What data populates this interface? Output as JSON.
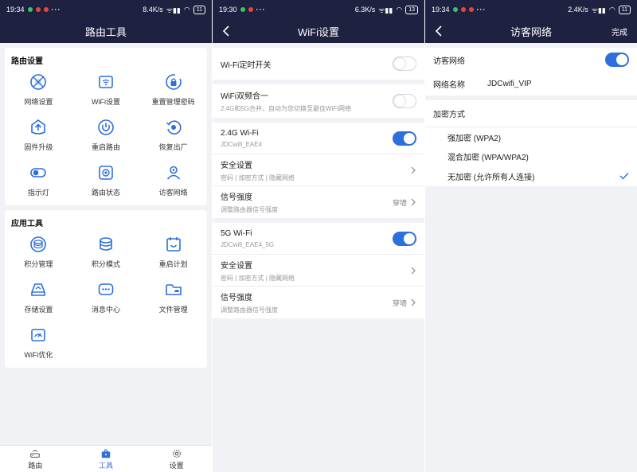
{
  "colors": {
    "navbar": "#1e2140",
    "accent": "#2d6fdb",
    "background": "#f1f2f6"
  },
  "screen1": {
    "status": {
      "time": "19:34",
      "dots": "···",
      "speed": "8.4K/s",
      "battery": "11"
    },
    "title": "路由工具",
    "router_section": {
      "title": "路由设置",
      "items": [
        {
          "label": "网络设置",
          "icon": "globe-icon"
        },
        {
          "label": "WiFi设置",
          "icon": "wifi-router-icon"
        },
        {
          "label": "重置管理密码",
          "icon": "lock-reset-icon"
        },
        {
          "label": "固件升级",
          "icon": "upgrade-icon"
        },
        {
          "label": "重启路由",
          "icon": "power-icon"
        },
        {
          "label": "恢复出厂",
          "icon": "restore-icon"
        },
        {
          "label": "指示灯",
          "icon": "toggle-light-icon"
        },
        {
          "label": "路由状态",
          "icon": "router-status-icon"
        },
        {
          "label": "访客网络",
          "icon": "guest-icon"
        }
      ]
    },
    "app_section": {
      "title": "应用工具",
      "items": [
        {
          "label": "积分管理",
          "icon": "points-icon"
        },
        {
          "label": "积分模式",
          "icon": "points-mode-icon"
        },
        {
          "label": "重启计划",
          "icon": "calendar-icon"
        },
        {
          "label": "存储设置",
          "icon": "storage-icon"
        },
        {
          "label": "消息中心",
          "icon": "message-icon"
        },
        {
          "label": "文件管理",
          "icon": "folder-icon"
        },
        {
          "label": "WiFi优化",
          "icon": "wifi-optimize-icon"
        }
      ]
    },
    "tabs": [
      {
        "label": "路由",
        "icon": "router-tab-icon"
      },
      {
        "label": "工具",
        "icon": "toolbox-tab-icon"
      },
      {
        "label": "设置",
        "icon": "gear-icon"
      }
    ]
  },
  "screen2": {
    "status": {
      "time": "19:30",
      "dots": "···",
      "speed": "6.3K/s",
      "battery": "13"
    },
    "title": "WiFi设置",
    "timer_switch": "Wi-Fi定时开关",
    "dual_band": {
      "title": "WiFi双频合一",
      "subtitle": "2.4G和5G合并，自动为您切换至最佳WiFi网络"
    },
    "band24": {
      "title": "2.4G Wi-Fi",
      "ssid": "JDCwifi_EAE4",
      "security_title": "安全设置",
      "security_sub": "密码 | 加密方式 | 隐藏网络",
      "signal_title": "信号强度",
      "signal_sub": "调整路由器信号强度",
      "signal_value": "穿墙"
    },
    "band5": {
      "title": "5G Wi-Fi",
      "ssid": "JDCwifi_EAE4_5G",
      "security_title": "安全设置",
      "security_sub": "密码 | 加密方式 | 隐藏网络",
      "signal_title": "信号强度",
      "signal_sub": "调整路由器信号强度",
      "signal_value": "穿墙"
    }
  },
  "screen3": {
    "status": {
      "time": "19:34",
      "dots": "···",
      "speed": "2.4K/s",
      "battery": "11"
    },
    "title": "访客网络",
    "done": "完成",
    "guest_label": "访客网络",
    "name_label": "网络名称",
    "name_value": "JDCwifi_VIP",
    "encryption_title": "加密方式",
    "options": [
      "强加密 (WPA2)",
      "混合加密 (WPA/WPA2)",
      "无加密 (允许所有人连接)"
    ]
  }
}
